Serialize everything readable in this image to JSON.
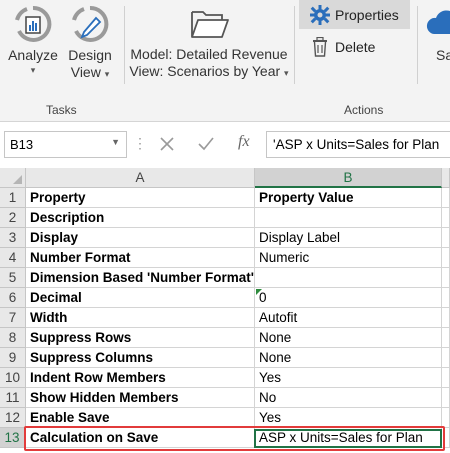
{
  "ribbon": {
    "analyze": {
      "label": "Analyze",
      "icon": "analyze-icon"
    },
    "design_view": {
      "line1": "Design",
      "line2": "View",
      "icon": "design-view-icon"
    },
    "model": {
      "line1": "Model: Detailed Revenue",
      "line2": "View: Scenarios by Year",
      "icon": "folder-icon"
    },
    "properties_label": "Properties",
    "delete_label": "Delete",
    "save_partial": "Sa",
    "tasks_group_label": "Tasks",
    "actions_group_label": "Actions"
  },
  "formula_bar": {
    "name_box": "B13",
    "fx_label": "fx",
    "formula": "'ASP x Units=Sales for Plan"
  },
  "columns": {
    "a": "A",
    "b": "B"
  },
  "rows": [
    {
      "num": "1",
      "a": "Property",
      "b": "Property Value",
      "b_bold": true
    },
    {
      "num": "2",
      "a": "Description",
      "b": ""
    },
    {
      "num": "3",
      "a": "Display",
      "b": "Display Label"
    },
    {
      "num": "4",
      "a": "Number Format",
      "b": "Numeric"
    },
    {
      "num": "5",
      "a": "Dimension Based 'Number Format'",
      "b": ""
    },
    {
      "num": "6",
      "a": "Decimal",
      "b": "0"
    },
    {
      "num": "7",
      "a": "Width",
      "b": "Autofit"
    },
    {
      "num": "8",
      "a": "Suppress Rows",
      "b": "None"
    },
    {
      "num": "9",
      "a": "Suppress Columns",
      "b": "None"
    },
    {
      "num": "10",
      "a": "Indent Row Members",
      "b": "Yes"
    },
    {
      "num": "11",
      "a": "Show Hidden Members",
      "b": "No"
    },
    {
      "num": "12",
      "a": "Enable Save",
      "b": "Yes"
    },
    {
      "num": "13",
      "a": "Calculation on Save",
      "b": "ASP x Units=Sales for Plan"
    }
  ],
  "colors": {
    "excel_green": "#217346",
    "highlight_red": "#e23b3b"
  }
}
